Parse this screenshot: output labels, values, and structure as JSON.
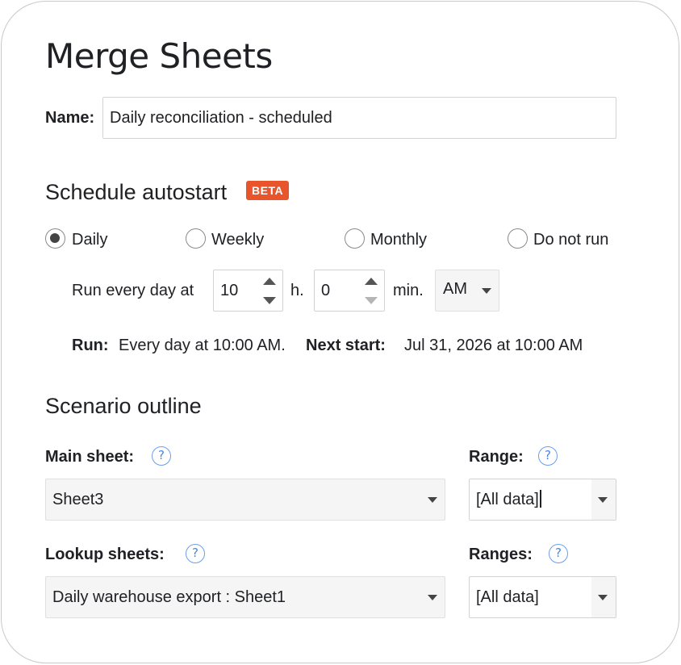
{
  "dialog": {
    "title": "Merge Sheets",
    "name_label": "Name:",
    "name_value": "Daily reconciliation - scheduled"
  },
  "schedule": {
    "title": "Schedule autostart",
    "badge": "BETA",
    "options": [
      {
        "label": "Daily",
        "checked": true
      },
      {
        "label": "Weekly",
        "checked": false
      },
      {
        "label": "Monthly",
        "checked": false
      },
      {
        "label": "Do not run",
        "checked": false
      }
    ],
    "run_every_label": "Run every day at",
    "hour_value": "10",
    "hour_unit": "h.",
    "minute_value": "0",
    "minute_unit": "min.",
    "ampm_value": "AM",
    "run_label": "Run:",
    "run_text": "Every day at 10:00 AM.",
    "next_start_label": "Next start:",
    "next_start_text": "Jul 31, 2026 at 10:00 AM"
  },
  "scenario": {
    "title": "Scenario outline",
    "main_sheet_label": "Main sheet:",
    "main_sheet_value": "Sheet3",
    "range_label": "Range:",
    "range_value": "[All data]",
    "lookup_label": "Lookup sheets:",
    "lookup_value": "Daily warehouse export : Sheet1",
    "ranges_label": "Ranges:",
    "ranges_value": "[All data]",
    "help_glyph": "?"
  },
  "colors": {
    "beta_badge": "#e8542c",
    "help_icon": "#4a86e8"
  }
}
